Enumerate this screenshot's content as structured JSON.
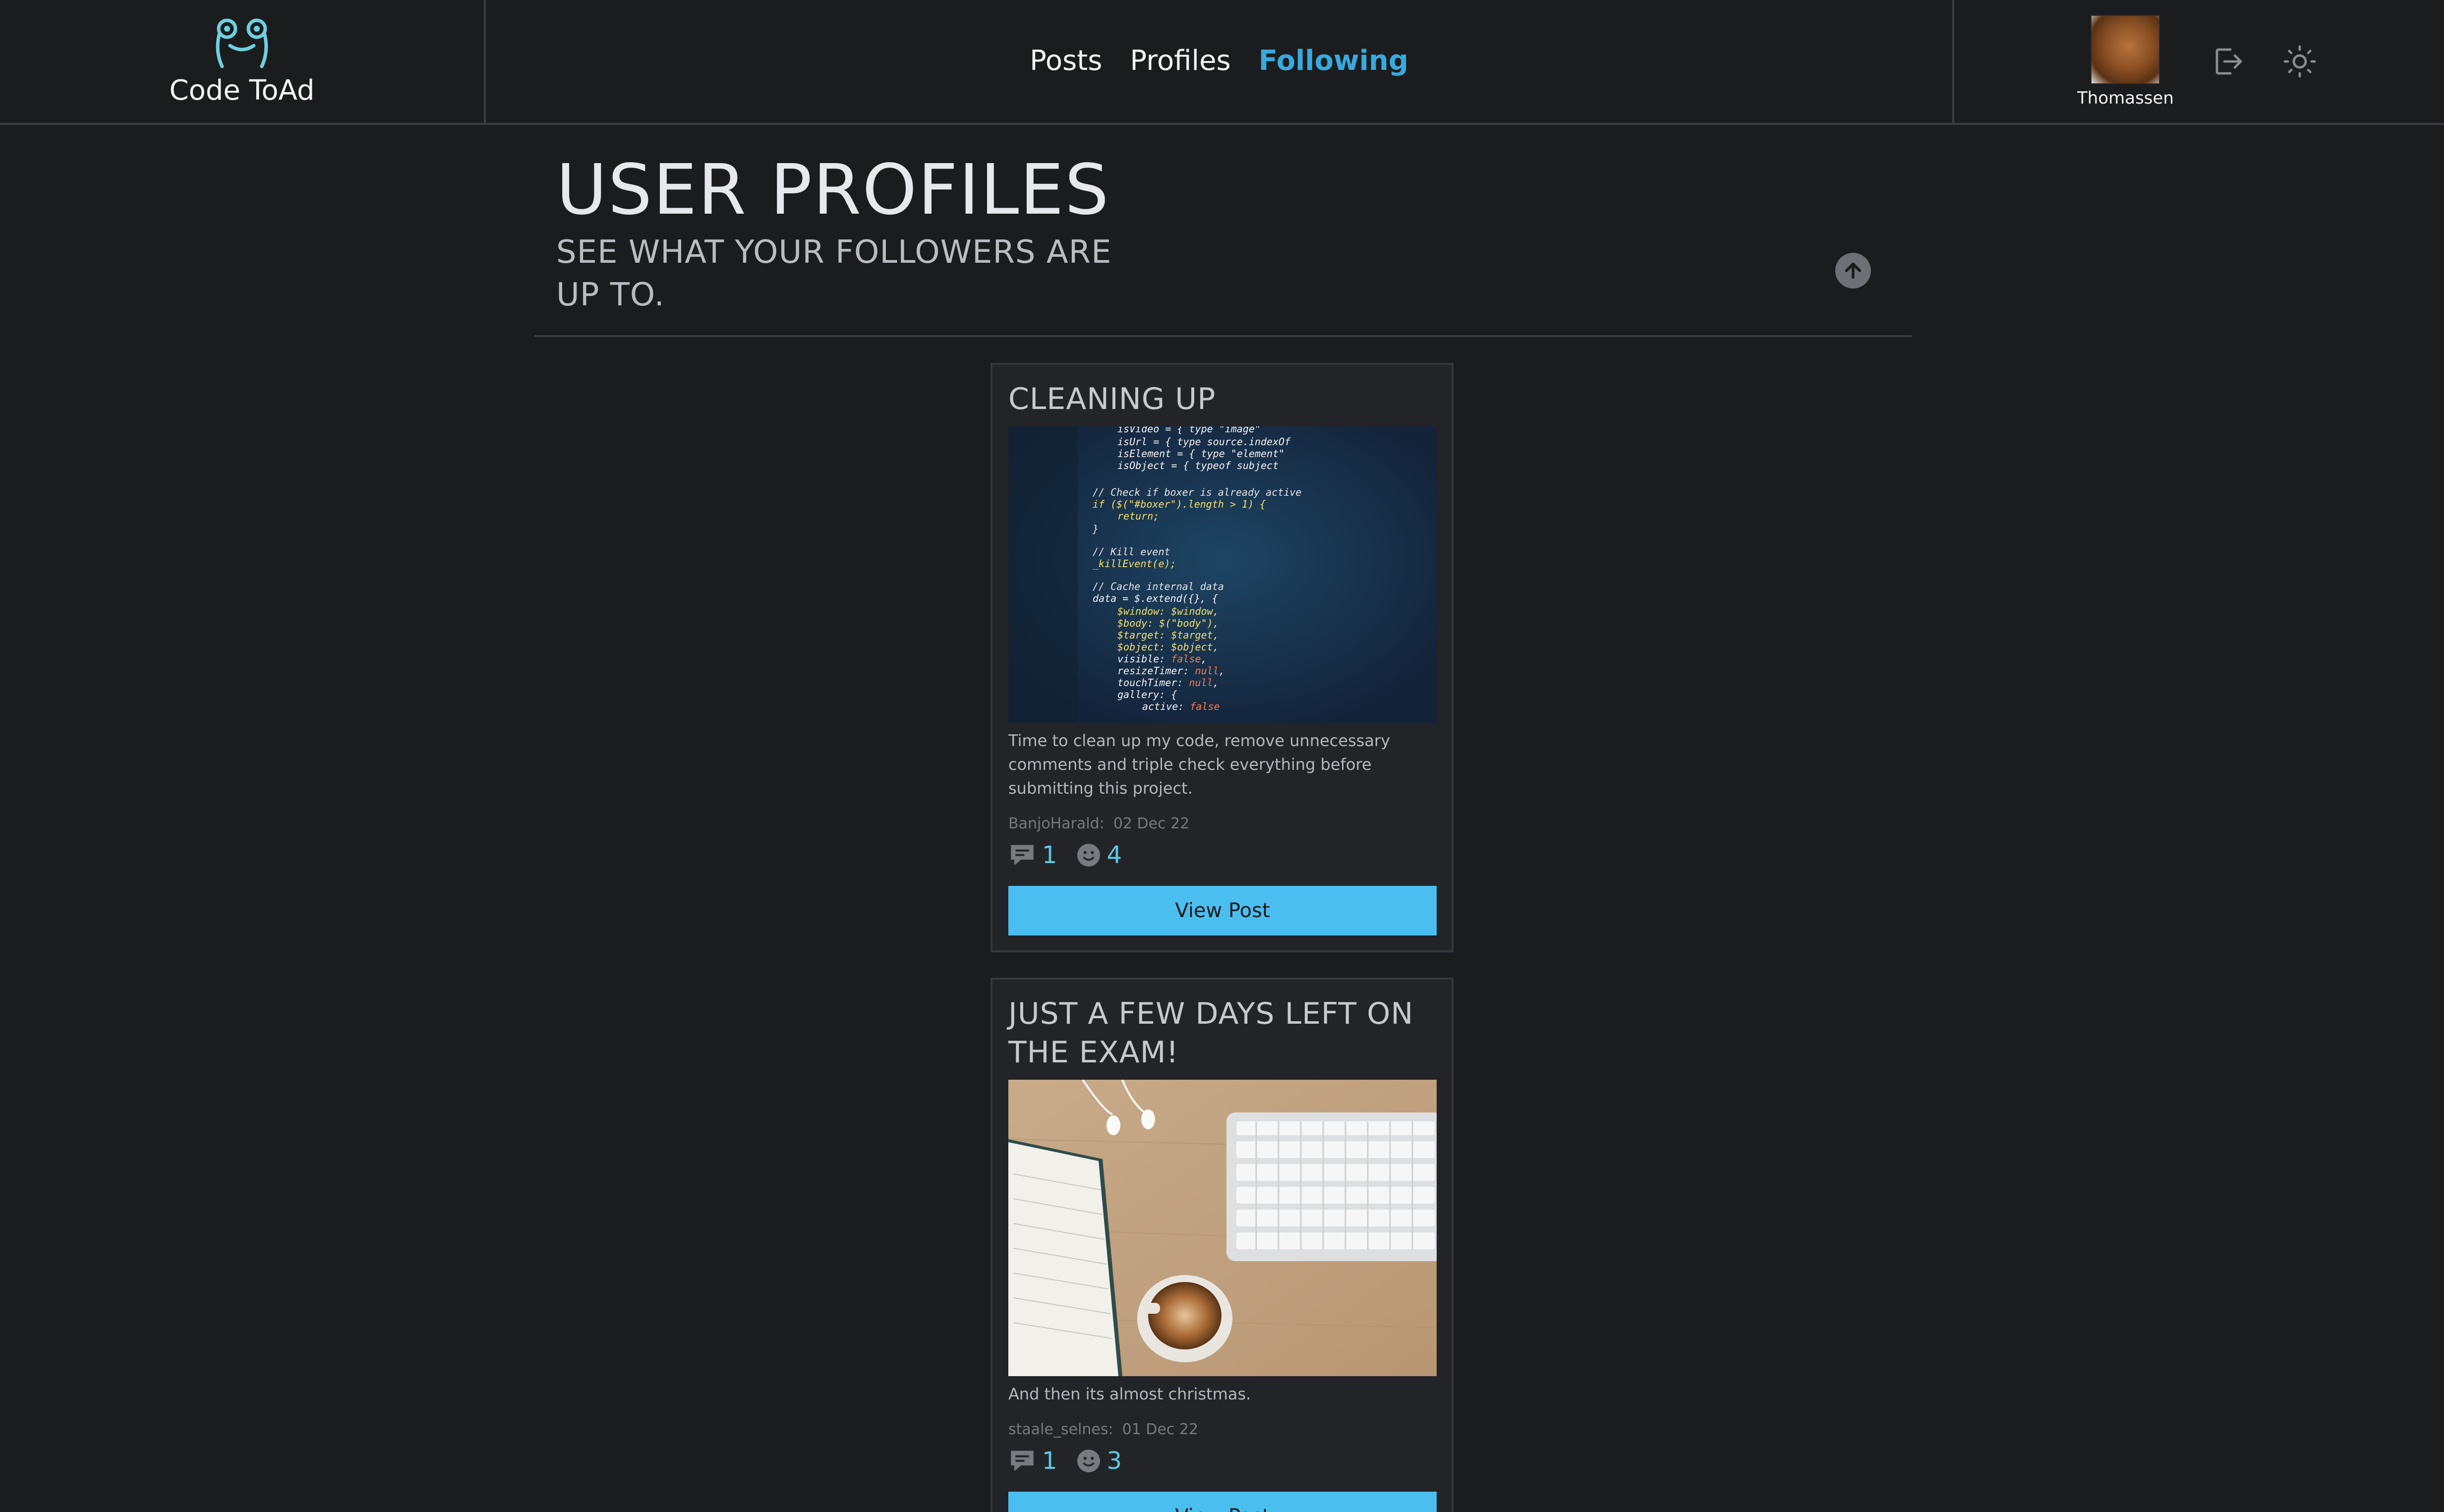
{
  "brand": {
    "name": "Code ToAd",
    "logo_icon": "frog-icon"
  },
  "nav": {
    "items": [
      {
        "label": "Posts",
        "active": false
      },
      {
        "label": "Profiles",
        "active": false
      },
      {
        "label": "Following",
        "active": true
      }
    ]
  },
  "user": {
    "name": "Thomassen",
    "logout_icon": "logout-icon",
    "theme_icon": "sun-icon"
  },
  "page": {
    "title": "USER PROFILES",
    "subtitle": "SEE WHAT YOUR FOLLOWERS ARE UP TO.",
    "scroll_icon": "arrow-up-icon"
  },
  "posts": [
    {
      "title": "CLEANING UP",
      "body": "Time to clean up my code, remove unnecessary comments and triple check everything before submitting this project.",
      "author": "BanjoHarald:",
      "date": "02 Dec 22",
      "comments": "1",
      "reactions": "4",
      "button": "View Post"
    },
    {
      "title": "JUST A FEW DAYS LEFT ON THE EXAM!",
      "body": "And then its almost christmas.",
      "author": "staale_selnes:",
      "date": "01 Dec 22",
      "comments": "1",
      "reactions": "3",
      "button": "View Post"
    }
  ],
  "colors": {
    "accent": "#38a9de",
    "button": "#4bbef0",
    "background": "#1b1c1e",
    "card": "#232427"
  }
}
